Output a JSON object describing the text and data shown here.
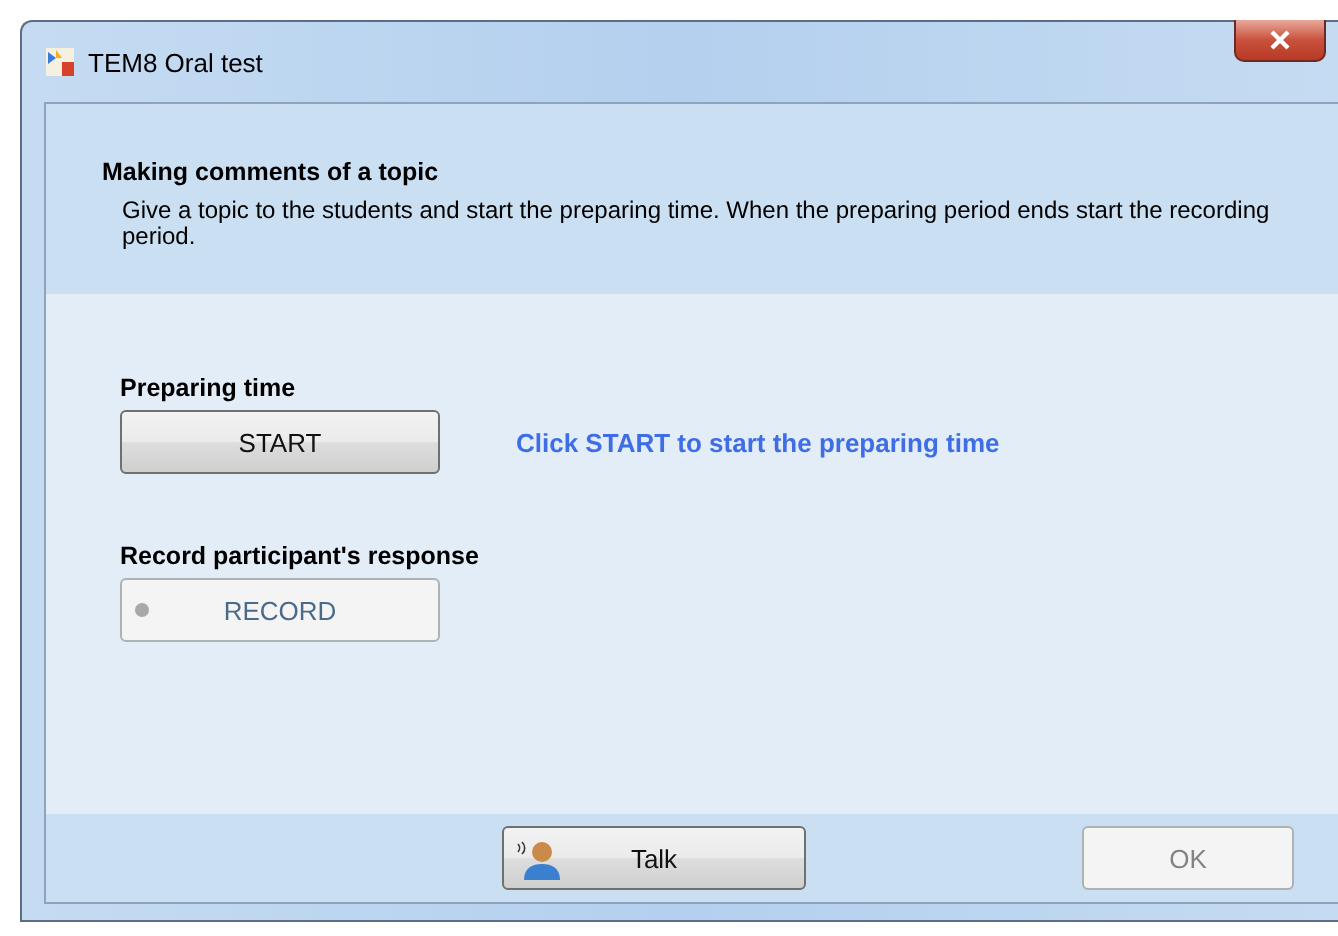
{
  "window": {
    "title": "TEM8 Oral test"
  },
  "header": {
    "title": "Making comments of a topic",
    "description": "Give a topic to the students and start the preparing time. When the preparing period ends start the recording period."
  },
  "sections": [
    {
      "label": "Preparing time",
      "button": {
        "label": "START",
        "kind": "start",
        "disabled": false
      },
      "hint": "Click START to start the preparing time"
    },
    {
      "label": "Record participant's response",
      "button": {
        "label": "RECORD",
        "kind": "record",
        "disabled": true
      }
    }
  ],
  "footer": {
    "buttons": [
      {
        "label": "Talk",
        "kind": "talk",
        "disabled": false
      },
      {
        "label": "OK",
        "kind": "plain",
        "disabled": true
      }
    ]
  }
}
